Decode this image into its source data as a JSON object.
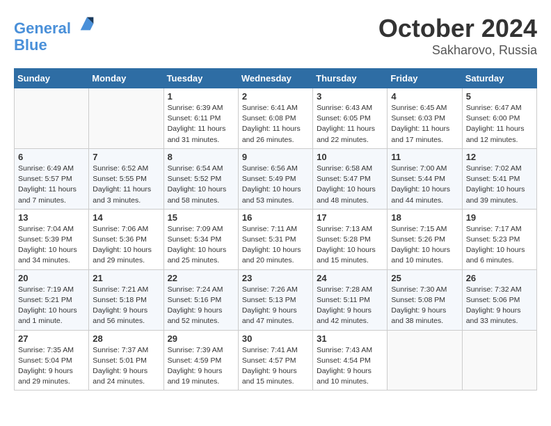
{
  "header": {
    "logo_line1": "General",
    "logo_line2": "Blue",
    "month": "October 2024",
    "location": "Sakharovo, Russia"
  },
  "weekdays": [
    "Sunday",
    "Monday",
    "Tuesday",
    "Wednesday",
    "Thursday",
    "Friday",
    "Saturday"
  ],
  "weeks": [
    [
      {
        "day": "",
        "info": ""
      },
      {
        "day": "",
        "info": ""
      },
      {
        "day": "1",
        "info": "Sunrise: 6:39 AM\nSunset: 6:11 PM\nDaylight: 11 hours and 31 minutes."
      },
      {
        "day": "2",
        "info": "Sunrise: 6:41 AM\nSunset: 6:08 PM\nDaylight: 11 hours and 26 minutes."
      },
      {
        "day": "3",
        "info": "Sunrise: 6:43 AM\nSunset: 6:05 PM\nDaylight: 11 hours and 22 minutes."
      },
      {
        "day": "4",
        "info": "Sunrise: 6:45 AM\nSunset: 6:03 PM\nDaylight: 11 hours and 17 minutes."
      },
      {
        "day": "5",
        "info": "Sunrise: 6:47 AM\nSunset: 6:00 PM\nDaylight: 11 hours and 12 minutes."
      }
    ],
    [
      {
        "day": "6",
        "info": "Sunrise: 6:49 AM\nSunset: 5:57 PM\nDaylight: 11 hours and 7 minutes."
      },
      {
        "day": "7",
        "info": "Sunrise: 6:52 AM\nSunset: 5:55 PM\nDaylight: 11 hours and 3 minutes."
      },
      {
        "day": "8",
        "info": "Sunrise: 6:54 AM\nSunset: 5:52 PM\nDaylight: 10 hours and 58 minutes."
      },
      {
        "day": "9",
        "info": "Sunrise: 6:56 AM\nSunset: 5:49 PM\nDaylight: 10 hours and 53 minutes."
      },
      {
        "day": "10",
        "info": "Sunrise: 6:58 AM\nSunset: 5:47 PM\nDaylight: 10 hours and 48 minutes."
      },
      {
        "day": "11",
        "info": "Sunrise: 7:00 AM\nSunset: 5:44 PM\nDaylight: 10 hours and 44 minutes."
      },
      {
        "day": "12",
        "info": "Sunrise: 7:02 AM\nSunset: 5:41 PM\nDaylight: 10 hours and 39 minutes."
      }
    ],
    [
      {
        "day": "13",
        "info": "Sunrise: 7:04 AM\nSunset: 5:39 PM\nDaylight: 10 hours and 34 minutes."
      },
      {
        "day": "14",
        "info": "Sunrise: 7:06 AM\nSunset: 5:36 PM\nDaylight: 10 hours and 29 minutes."
      },
      {
        "day": "15",
        "info": "Sunrise: 7:09 AM\nSunset: 5:34 PM\nDaylight: 10 hours and 25 minutes."
      },
      {
        "day": "16",
        "info": "Sunrise: 7:11 AM\nSunset: 5:31 PM\nDaylight: 10 hours and 20 minutes."
      },
      {
        "day": "17",
        "info": "Sunrise: 7:13 AM\nSunset: 5:28 PM\nDaylight: 10 hours and 15 minutes."
      },
      {
        "day": "18",
        "info": "Sunrise: 7:15 AM\nSunset: 5:26 PM\nDaylight: 10 hours and 10 minutes."
      },
      {
        "day": "19",
        "info": "Sunrise: 7:17 AM\nSunset: 5:23 PM\nDaylight: 10 hours and 6 minutes."
      }
    ],
    [
      {
        "day": "20",
        "info": "Sunrise: 7:19 AM\nSunset: 5:21 PM\nDaylight: 10 hours and 1 minute."
      },
      {
        "day": "21",
        "info": "Sunrise: 7:21 AM\nSunset: 5:18 PM\nDaylight: 9 hours and 56 minutes."
      },
      {
        "day": "22",
        "info": "Sunrise: 7:24 AM\nSunset: 5:16 PM\nDaylight: 9 hours and 52 minutes."
      },
      {
        "day": "23",
        "info": "Sunrise: 7:26 AM\nSunset: 5:13 PM\nDaylight: 9 hours and 47 minutes."
      },
      {
        "day": "24",
        "info": "Sunrise: 7:28 AM\nSunset: 5:11 PM\nDaylight: 9 hours and 42 minutes."
      },
      {
        "day": "25",
        "info": "Sunrise: 7:30 AM\nSunset: 5:08 PM\nDaylight: 9 hours and 38 minutes."
      },
      {
        "day": "26",
        "info": "Sunrise: 7:32 AM\nSunset: 5:06 PM\nDaylight: 9 hours and 33 minutes."
      }
    ],
    [
      {
        "day": "27",
        "info": "Sunrise: 7:35 AM\nSunset: 5:04 PM\nDaylight: 9 hours and 29 minutes."
      },
      {
        "day": "28",
        "info": "Sunrise: 7:37 AM\nSunset: 5:01 PM\nDaylight: 9 hours and 24 minutes."
      },
      {
        "day": "29",
        "info": "Sunrise: 7:39 AM\nSunset: 4:59 PM\nDaylight: 9 hours and 19 minutes."
      },
      {
        "day": "30",
        "info": "Sunrise: 7:41 AM\nSunset: 4:57 PM\nDaylight: 9 hours and 15 minutes."
      },
      {
        "day": "31",
        "info": "Sunrise: 7:43 AM\nSunset: 4:54 PM\nDaylight: 9 hours and 10 minutes."
      },
      {
        "day": "",
        "info": ""
      },
      {
        "day": "",
        "info": ""
      }
    ]
  ]
}
